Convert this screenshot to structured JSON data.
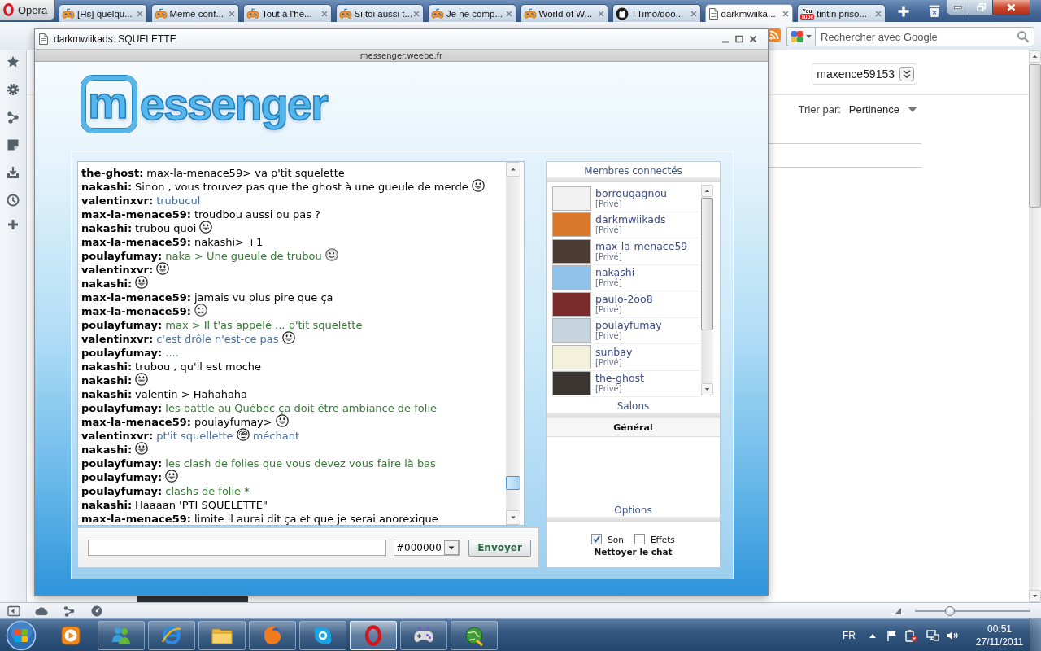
{
  "browser": {
    "menu_button": "Opera",
    "tabs": [
      {
        "label": "[Hs] quelqu...",
        "kind": "game",
        "selected": false
      },
      {
        "label": "Meme conf...",
        "kind": "game",
        "selected": false
      },
      {
        "label": "Tout à l'he...",
        "kind": "game",
        "selected": false
      },
      {
        "label": "Si toi aussi t...",
        "kind": "game",
        "selected": false
      },
      {
        "label": "Je ne comp...",
        "kind": "game",
        "selected": false
      },
      {
        "label": "World of W...",
        "kind": "game",
        "selected": false
      },
      {
        "label": "TTimo/doo...",
        "kind": "code",
        "selected": false
      },
      {
        "label": "darkmwiika...",
        "kind": "page",
        "selected": true
      },
      {
        "label": "tintin priso...",
        "kind": "video",
        "logo_text": [
          "You",
          "Tube"
        ],
        "selected": false
      }
    ],
    "search": {
      "placeholder": "Rechercher avec Google"
    }
  },
  "page": {
    "account": "maxence59153",
    "sort_label": "Trier par:",
    "sort_value": "Pertinence"
  },
  "popup": {
    "title": "darkmwiikads: SQUELETTE",
    "url": "messenger.weebe.fr",
    "logo": [
      {
        "text": "m",
        "boxed": true
      },
      {
        "text": "essenger",
        "boxed": false
      }
    ],
    "chat": {
      "messages": [
        {
          "user": "the-ghost:",
          "color": "#000000",
          "parts": [
            {
              "kind": "text",
              "text": "max-la-menace59> va p'tit squelette"
            }
          ]
        },
        {
          "user": "nakashi:",
          "color": "#000000",
          "parts": [
            {
              "kind": "text",
              "text": "Sinon , vous trouvez pas que the ghost à une gueule de merde"
            },
            {
              "kind": "grin"
            }
          ]
        },
        {
          "user": "valentinxvr:",
          "color": "#4a70a0",
          "parts": [
            {
              "kind": "text",
              "text": "trubucul"
            }
          ]
        },
        {
          "user": "max-la-menace59:",
          "color": "#000000",
          "parts": [
            {
              "kind": "text",
              "text": "troudbou aussi ou pas ?"
            }
          ]
        },
        {
          "user": "nakashi:",
          "color": "#000000",
          "parts": [
            {
              "kind": "text",
              "text": "trubou quoi"
            },
            {
              "kind": "grin"
            }
          ]
        },
        {
          "user": "max-la-menace59:",
          "color": "#000000",
          "parts": [
            {
              "kind": "text",
              "text": "nakashi> +1"
            }
          ]
        },
        {
          "user": "poulayfumay:",
          "color": "#357a35",
          "parts": [
            {
              "kind": "text",
              "text": "naka > Une gueule de trubou"
            },
            {
              "kind": "smile"
            }
          ]
        },
        {
          "user": "valentinxvr:",
          "parts": [
            {
              "kind": "grin"
            }
          ]
        },
        {
          "user": "nakashi:",
          "parts": [
            {
              "kind": "grin"
            }
          ]
        },
        {
          "user": "max-la-menace59:",
          "color": "#000000",
          "parts": [
            {
              "kind": "text",
              "text": "jamais vu plus pire que ça"
            }
          ]
        },
        {
          "user": "max-la-menace59:",
          "parts": [
            {
              "kind": "sad"
            }
          ]
        },
        {
          "user": "poulayfumay:",
          "color": "#357a35",
          "parts": [
            {
              "kind": "text",
              "text": "max > Il t'as appelé ... p'tit squelette"
            }
          ]
        },
        {
          "user": "valentinxvr:",
          "color": "#4a70a0",
          "parts": [
            {
              "kind": "text",
              "text": "c'est drôle n'est-ce pas"
            },
            {
              "kind": "grin"
            }
          ]
        },
        {
          "user": "poulayfumay:",
          "color": "#357a35",
          "parts": [
            {
              "kind": "text",
              "text": "...."
            }
          ]
        },
        {
          "user": "nakashi:",
          "color": "#000000",
          "parts": [
            {
              "kind": "text",
              "text": "trubou , qu'il est moche"
            }
          ]
        },
        {
          "user": "nakashi:",
          "parts": [
            {
              "kind": "grin"
            }
          ]
        },
        {
          "user": "nakashi:",
          "color": "#000000",
          "parts": [
            {
              "kind": "text",
              "text": "valentin > Hahahaha"
            }
          ]
        },
        {
          "user": "poulayfumay:",
          "color": "#357a35",
          "parts": [
            {
              "kind": "text",
              "text": "les battle au Québec ça doit être ambiance de folie"
            }
          ]
        },
        {
          "user": "max-la-menace59:",
          "color": "#000000",
          "parts": [
            {
              "kind": "text",
              "text": "poulayfumay>"
            },
            {
              "kind": "grin"
            }
          ]
        },
        {
          "user": "valentinxvr:",
          "color": "#4a70a0",
          "parts": [
            {
              "kind": "text",
              "text": "pt'it squellette"
            },
            {
              "kind": "crazy"
            },
            {
              "kind": "text",
              "text": "méchant"
            }
          ]
        },
        {
          "user": "nakashi:",
          "parts": [
            {
              "kind": "grin"
            }
          ]
        },
        {
          "user": "poulayfumay:",
          "color": "#357a35",
          "parts": [
            {
              "kind": "text",
              "text": "les clash de folies que vous devez vous faire là bas"
            }
          ]
        },
        {
          "user": "poulayfumay:",
          "parts": [
            {
              "kind": "grin"
            }
          ]
        },
        {
          "user": "poulayfumay:",
          "color": "#357a35",
          "parts": [
            {
              "kind": "text",
              "text": "clashs de folie *"
            }
          ]
        },
        {
          "user": "nakashi:",
          "color": "#000000",
          "parts": [
            {
              "kind": "text",
              "text": "Haaaan 'PTI SQUELETTE\""
            }
          ]
        },
        {
          "user": "max-la-menace59:",
          "color": "#000000",
          "parts": [
            {
              "kind": "text",
              "text": "limite il aurai dit ça et que je serai anorexique"
            }
          ]
        }
      ],
      "color_select": "#000000",
      "send_button": "Envoyer"
    },
    "members": {
      "title": "Membres connectés",
      "items": [
        {
          "name": "borrougagnou",
          "link": "[Privé]",
          "color": "#f2f2f2"
        },
        {
          "name": "darkmwiikads",
          "link": "[Privé]",
          "color": "#d9782a"
        },
        {
          "name": "max-la-menace59",
          "link": "[Privé]",
          "color": "#4b3b32"
        },
        {
          "name": "nakashi",
          "link": "[Privé]",
          "color": "#8fc3ea"
        },
        {
          "name": "paulo-2oo8",
          "link": "[Privé]",
          "color": "#7a2a28"
        },
        {
          "name": "poulayfumay",
          "link": "[Privé]",
          "color": "#c5d3dc"
        },
        {
          "name": "sunbay",
          "link": "[Privé]",
          "color": "#f3f1dc"
        },
        {
          "name": "the-ghost",
          "link": "[Privé]",
          "color": "#3b3532"
        }
      ]
    },
    "rooms": {
      "title": "Salons",
      "items": [
        {
          "name": "Général",
          "selected": true
        }
      ]
    },
    "options": {
      "title": "Options",
      "checkboxes": [
        {
          "label": "Son",
          "checked": true
        },
        {
          "label": "Effets",
          "checked": false
        }
      ],
      "clear_link": "Nettoyer le chat"
    }
  },
  "status_bar": {
    "zoom": {
      "level": 0.3
    }
  },
  "taskbar": {
    "apps": [
      {
        "kind": "player",
        "running": false,
        "selected": false
      },
      {
        "kind": "people",
        "running": true,
        "selected": false
      },
      {
        "kind": "browser",
        "running": true,
        "selected": false
      },
      {
        "kind": "folder",
        "running": true,
        "selected": false
      },
      {
        "kind": "fox",
        "running": true,
        "selected": false
      },
      {
        "kind": "phone",
        "running": true,
        "selected": false
      },
      {
        "kind": "ring",
        "running": true,
        "selected": true
      },
      {
        "kind": "gamepad",
        "running": true,
        "selected": false
      },
      {
        "kind": "globe",
        "running": true,
        "selected": false
      }
    ],
    "language": "FR",
    "time": "00:51",
    "date": "27/11/2011"
  }
}
